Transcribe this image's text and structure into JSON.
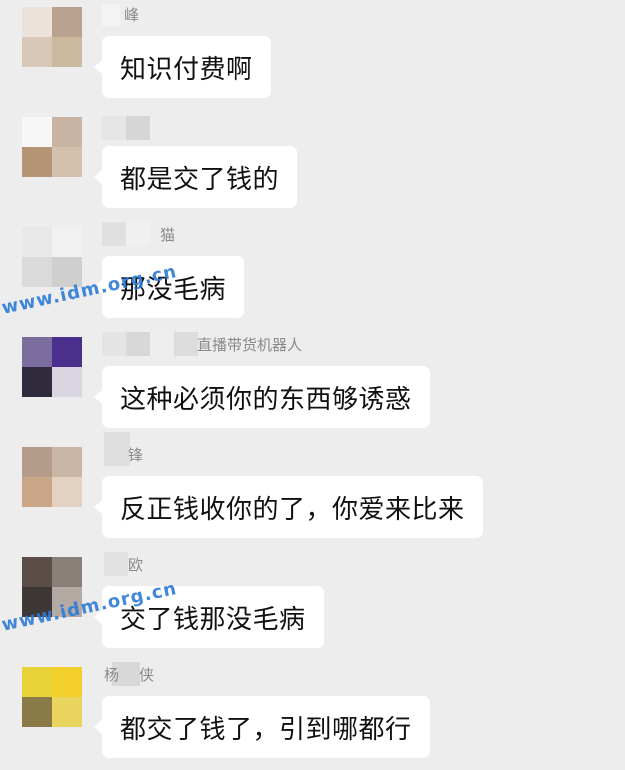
{
  "messages": [
    {
      "sender": "峰",
      "text": "知识付费啊",
      "avatar_colors": [
        "#ebe3db",
        "#b9a290",
        "#d9c8b7",
        "#cbb99f"
      ],
      "name_mosaic": [
        "#f3f3f3"
      ]
    },
    {
      "sender": "",
      "text": "都是交了钱的",
      "avatar_colors": [
        "#f7f7f7",
        "#c9b4a3",
        "#b59576",
        "#d4c0ad"
      ],
      "name_mosaic": [
        "#e6e6e6",
        "#d6d6d6"
      ]
    },
    {
      "sender": "猫",
      "text": "那没毛病",
      "avatar_colors": [
        "#e8e8e8",
        "#f1f1f1",
        "#dadada",
        "#cfcfcf"
      ],
      "name_mosaic": [
        "#e0e0e0",
        "#f0f0f0"
      ]
    },
    {
      "sender": "直播带货机器人",
      "text": "这种必须你的东西够诱惑",
      "avatar_colors": [
        "#7b6d9e",
        "#4a2f8c",
        "#2f2b3d",
        "#d9d6e2"
      ],
      "name_mosaic": [
        "#e4e4e4",
        "#d8d8d8",
        "#eeeeee",
        "#dcdcdc"
      ]
    },
    {
      "sender": "锋",
      "text": "反正钱收你的了，你爱来比来",
      "avatar_colors": [
        "#b59c8a",
        "#c9b6a6",
        "#caa789",
        "#e3d2c2"
      ],
      "name_mosaic": [
        "#dedede"
      ]
    },
    {
      "sender": "欧",
      "text": "交了钱那没毛病",
      "avatar_colors": [
        "#5a4d47",
        "#8a7e78",
        "#3d3835",
        "#b3aaa4"
      ],
      "name_mosaic": [
        "#e2e2e2"
      ]
    },
    {
      "sender": "杨侠",
      "text": "都交了钱了，引到哪都行",
      "avatar_colors": [
        "#e8d23a",
        "#f2cf2a",
        "#8a7a48",
        "#ead460"
      ],
      "name_mosaic": [
        "#d8d8d8"
      ]
    }
  ],
  "watermarks": [
    "www.idm.org.cn",
    "www.idm.org.cn"
  ]
}
